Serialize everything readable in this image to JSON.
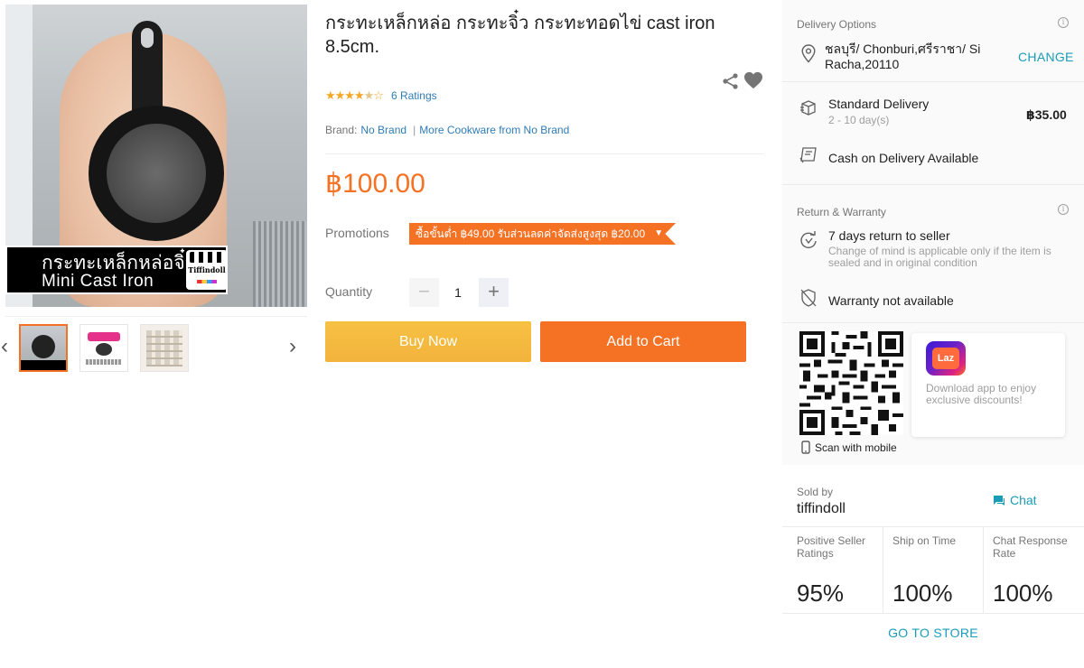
{
  "product": {
    "title": "กระทะเหล็กหล่อ กระทะจิ๋ว กระทะทอดไข่ cast iron 8.5cm.",
    "rating_stars": "★★★★",
    "rating_half": "★",
    "rating_empty": "☆",
    "ratings_count": "6 Ratings",
    "brand_label": "Brand:",
    "brand_name": "No Brand",
    "brand_separator": "|",
    "more_from_brand": "More Cookware from No Brand",
    "price": "฿100.00",
    "promotions_label": "Promotions",
    "promotion_tag": "ซื้อขั้นต่ำ ฿49.00 รับส่วนลดค่าจัดส่งสูงสุด ฿20.00",
    "quantity_label": "Quantity",
    "quantity_value": "1",
    "buy_now": "Buy Now",
    "add_to_cart": "Add to Cart"
  },
  "gallery": {
    "main_caption_line1": "กระทะเหล็กหล่อจิ๋ว",
    "main_caption_line2": "Mini Cast Iron",
    "logo_text": "Tiffindoll",
    "prev_arrow": "‹",
    "next_arrow": "›"
  },
  "delivery": {
    "section_title": "Delivery Options",
    "location": "ชลบุรี/ Chonburi,ศรีราชา/ Si Racha,20110",
    "change": "CHANGE",
    "standard_title": "Standard Delivery",
    "standard_time": "2 - 10 day(s)",
    "standard_price": "฿35.00",
    "cod": "Cash on Delivery Available"
  },
  "returns": {
    "section_title": "Return & Warranty",
    "return_title": "7 days return to seller",
    "return_sub": "Change of mind is applicable only if the item is sealed and in original condition",
    "warranty": "Warranty not available"
  },
  "app": {
    "scan": "Scan with mobile",
    "logo_text": "Laz",
    "promo": "Download app to enjoy exclusive discounts!"
  },
  "seller": {
    "sold_by": "Sold by",
    "name": "tiffindoll",
    "chat": "Chat",
    "metrics": [
      {
        "label": "Positive Seller Ratings",
        "value": "95%"
      },
      {
        "label": "Ship on Time",
        "value": "100%"
      },
      {
        "label": "Chat Response Rate",
        "value": "100%"
      }
    ],
    "go_to_store": "GO TO STORE"
  },
  "colors": {
    "accent_orange": "#f57224",
    "buy_yellow": "#f6c343",
    "link_blue": "#2f7cb5",
    "teal": "#1a9cb7"
  }
}
